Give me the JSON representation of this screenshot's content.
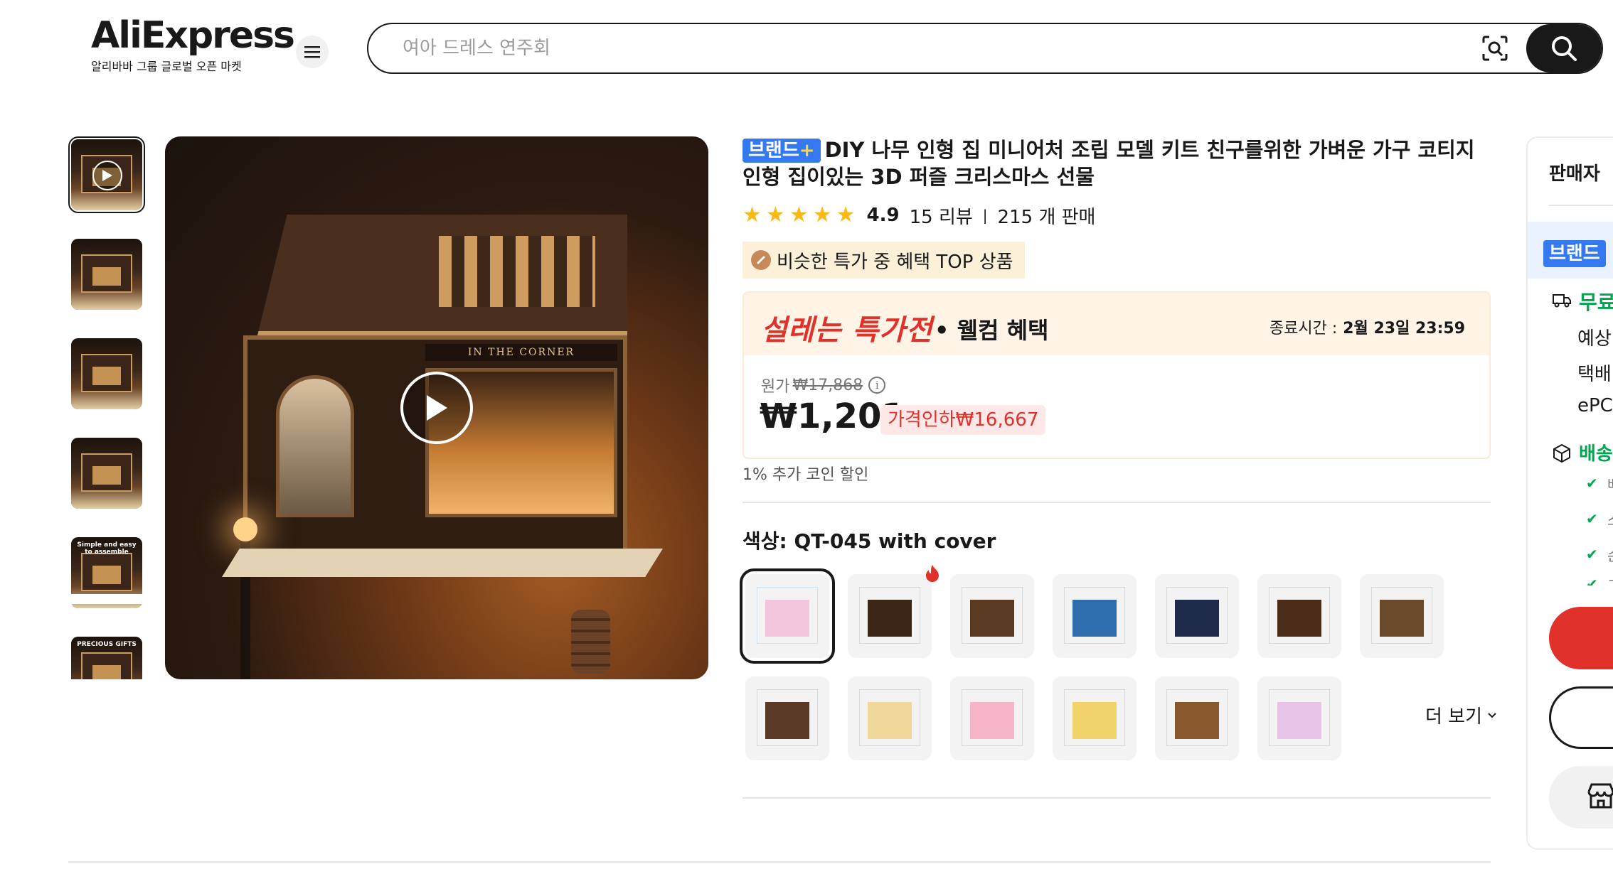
{
  "header": {
    "logo_text": "AliExpress",
    "logo_tagline": "알리바바 그룹 글로벌 오픈 마켓",
    "search_placeholder": "여아 드레스 연주회",
    "icons": {
      "menu": "hamburger-icon",
      "camera": "camera-search-icon",
      "search": "search-icon"
    }
  },
  "gallery": {
    "thumbnails": [
      {
        "caption": "",
        "video": true
      },
      {
        "caption": ""
      },
      {
        "caption": ""
      },
      {
        "caption": ""
      },
      {
        "caption": "Simple and easy to assemble"
      },
      {
        "caption": "PRECIOUS GIFTS"
      }
    ],
    "main_sign_text": "IN THE CORNER"
  },
  "product": {
    "brand_badge": "브랜드",
    "brand_badge_plus": "+",
    "title": "DIY 나무 인형 집 미니어처 조립 모델 키트 친구를위한 가벼운 가구 코티지 인형 집이있는 3D 퍼즐 크리스마스 선물",
    "rating": "4.9",
    "reviews": "15 리뷰",
    "sold": "215 개 판매",
    "top_badge": "비슷한 특가 중 혜택 TOP 상품",
    "deal": {
      "name": "설레는 특가전",
      "sub": "• 웰컴 혜택",
      "end_label": "종료시간 :",
      "end_time": "2월 23일 23:59",
      "original_label": "원가",
      "original_price": "₩17,868",
      "price": "₩1,201",
      "drop_label": "가격인하₩16,667"
    },
    "coin_text": "1% 추가 코인 할인",
    "color_label": "색상: QT-045 with cover",
    "more_label": "더 보기",
    "swatches_row1": [
      {
        "c": "#f4c6dd",
        "b": "#cfe3f7"
      },
      {
        "c": "#3a2517",
        "b": "#d9d9d9"
      },
      {
        "c": "#5b3a22",
        "b": "#d9d9d9"
      },
      {
        "c": "#2f6fb0",
        "b": "#d9d9d9"
      },
      {
        "c": "#1e2a4a",
        "b": "#d9d9d9"
      },
      {
        "c": "#4a2c19",
        "b": "#d9d9d9"
      },
      {
        "c": "#6b4a2c",
        "b": "#d9d9d9"
      }
    ],
    "swatches_row2": [
      {
        "c": "#5a3a26",
        "b": "#d9d9d9"
      },
      {
        "c": "#f0d79a",
        "b": "#d9d9d9"
      },
      {
        "c": "#f6b6c8",
        "b": "#d9d9d9"
      },
      {
        "c": "#f2d36a",
        "b": "#d9d9d9"
      },
      {
        "c": "#8a5a2e",
        "b": "#d9d9d9"
      },
      {
        "c": "#e8c3e8",
        "b": "#d9d9d9"
      }
    ]
  },
  "seller": {
    "title": "판매자",
    "badge": "브랜드",
    "shipping_title": "무료",
    "lines": [
      "예상",
      "택배",
      "ePC"
    ],
    "delivery_title": "배송",
    "checks": [
      "배",
      "소",
      "손",
      "고"
    ]
  },
  "colors": {
    "accent_red": "#e0322b",
    "brand_blue": "#3479f0",
    "star": "#fdb913",
    "green": "#00a650"
  }
}
